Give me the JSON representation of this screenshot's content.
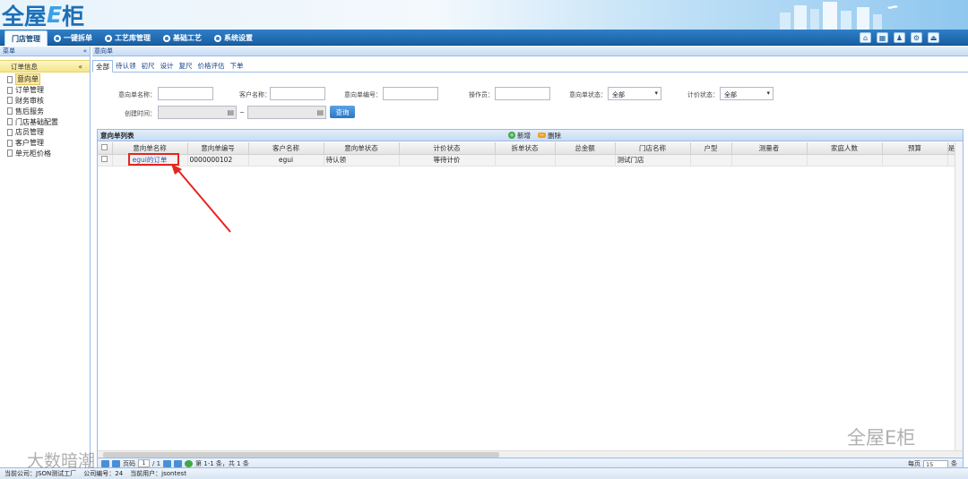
{
  "app": {
    "logo_main": "全屋",
    "logo_e": "E",
    "logo_tail": "柜"
  },
  "nav": {
    "tabs": [
      {
        "label": "门店管理"
      },
      {
        "label": "一键拆单"
      },
      {
        "label": "工艺库管理"
      },
      {
        "label": "基础工艺"
      },
      {
        "label": "系统设置"
      }
    ],
    "icons": [
      "home-icon",
      "calendar-icon",
      "user-icon",
      "gear-icon",
      "exit-icon"
    ]
  },
  "sidebar": {
    "header": "菜单",
    "collapse": "«",
    "group": "订单信息",
    "group_toggle": "«",
    "items": [
      {
        "label": "意向单"
      },
      {
        "label": "订单管理"
      },
      {
        "label": "财务审核"
      },
      {
        "label": "售后服务"
      },
      {
        "label": "门店基础配置"
      },
      {
        "label": "店员管理"
      },
      {
        "label": "客户管理"
      },
      {
        "label": "单元柜价格"
      }
    ]
  },
  "breadcrumb": "意向单",
  "subtabs": [
    "全部",
    "待认领",
    "初尺",
    "设计",
    "复尺",
    "价格评估",
    "下单"
  ],
  "form": {
    "order_name_label": "意向单名称：",
    "customer_label": "客户名称：",
    "order_no_label": "意向单编号：",
    "operator_label": "操作员：",
    "status_label": "意向单状态：",
    "status_value": "全部",
    "price_label": "计价状态：",
    "price_value": "全部",
    "created_label": "创建时间：",
    "date_sep": "~",
    "query_button": "查询"
  },
  "grid": {
    "title": "意向单列表",
    "add_label": "新增",
    "delete_label": "删除",
    "columns": [
      "",
      "意向单名称",
      "意向单编号",
      "客户名称",
      "意向单状态",
      "计价状态",
      "拆单状态",
      "总金额",
      "门店名称",
      "户型",
      "测量者",
      "家庭人数",
      "预算",
      "是"
    ],
    "rows": [
      [
        "",
        "egui的订单",
        "0000000102",
        "egui",
        "待认领",
        "等待计价",
        "",
        "",
        "测试门店",
        "",
        "",
        "",
        "",
        ""
      ]
    ]
  },
  "pager": {
    "page_label": "页码",
    "page": "1",
    "total_pages": "/ 1",
    "info": "第 1-1 条，共 1 条",
    "per_page_label": "每页",
    "per_page": "15",
    "per_page_unit": "条"
  },
  "status": {
    "company": "当前公司：JSON测试工厂",
    "company_no": "公司编号：24",
    "user": "当前用户：jsontest"
  },
  "watermarks": {
    "left": "大数暗潮",
    "right": "全屋E柜"
  }
}
